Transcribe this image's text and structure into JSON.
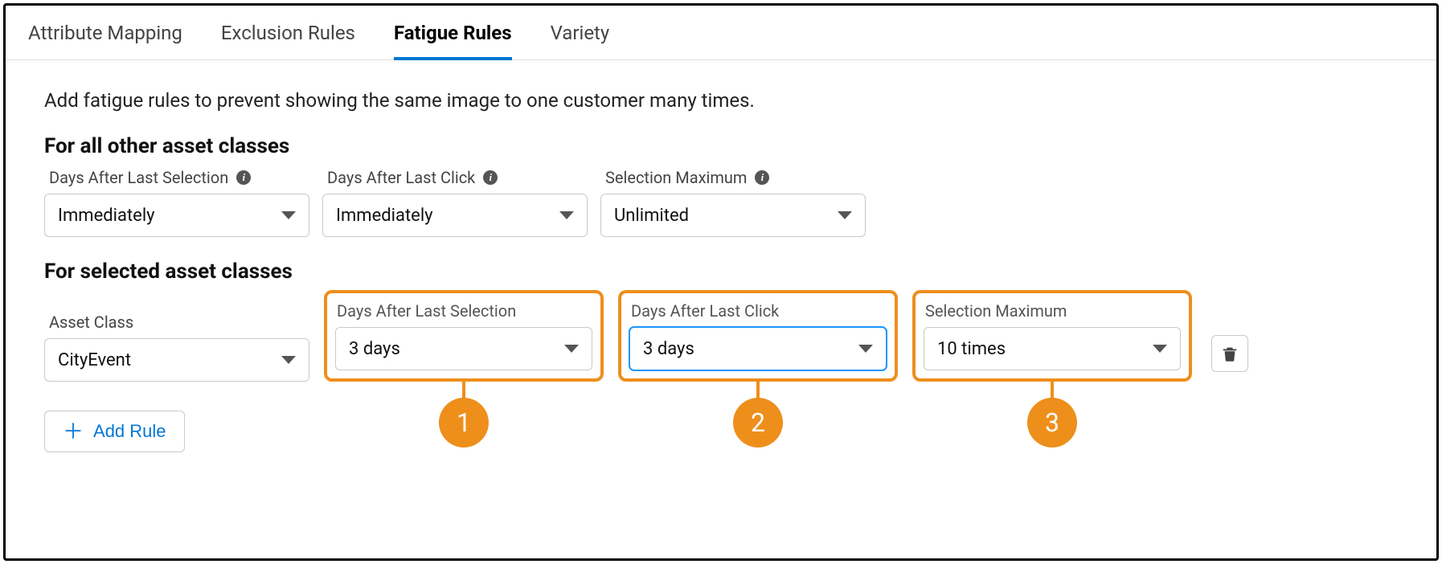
{
  "tabs": {
    "attribute_mapping": "Attribute Mapping",
    "exclusion_rules": "Exclusion Rules",
    "fatigue_rules": "Fatigue Rules",
    "variety": "Variety"
  },
  "intro": "Add fatigue rules to prevent showing the same image to one customer many times.",
  "section1": {
    "heading": "For all other asset classes",
    "days_after_last_selection_label": "Days After Last Selection",
    "days_after_last_selection_value": "Immediately",
    "days_after_last_click_label": "Days After Last Click",
    "days_after_last_click_value": "Immediately",
    "selection_maximum_label": "Selection Maximum",
    "selection_maximum_value": "Unlimited"
  },
  "section2": {
    "heading": "For selected asset classes",
    "asset_class_label": "Asset Class",
    "asset_class_value": "CityEvent",
    "days_after_last_selection_label": "Days After Last Selection",
    "days_after_last_selection_value": "3 days",
    "days_after_last_click_label": "Days After Last Click",
    "days_after_last_click_value": "3 days",
    "selection_maximum_label": "Selection Maximum",
    "selection_maximum_value": "10 times"
  },
  "callouts": {
    "one": "1",
    "two": "2",
    "three": "3"
  },
  "buttons": {
    "add_rule": "Add Rule"
  },
  "colors": {
    "accent": "#0176d3",
    "highlight": "#ee8f1c"
  }
}
